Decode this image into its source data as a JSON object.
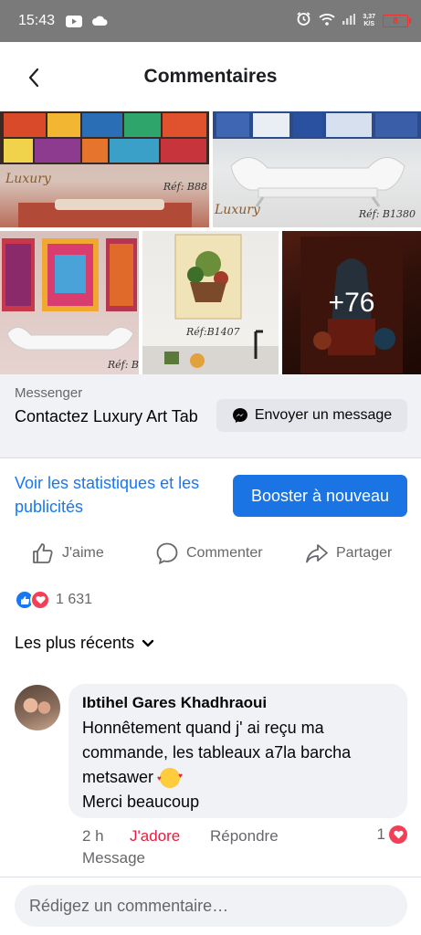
{
  "status_bar": {
    "time": "15:43",
    "net_speed_top": "3,37",
    "net_speed_bottom": "K/S",
    "battery": "8"
  },
  "header": {
    "title": "Commentaires"
  },
  "gallery": {
    "refs": [
      "Réf: B88",
      "Réf: B1380",
      "Réf: B",
      "Réf:B1407"
    ],
    "brand": "Luxury",
    "more_count": "+76"
  },
  "messenger": {
    "label": "Messenger",
    "contact": "Contactez Luxury Art Tab",
    "send_label": "Envoyer un message"
  },
  "promo": {
    "stats_link": "Voir les statistiques et les publicités",
    "boost_label": "Booster à nouveau"
  },
  "actions": {
    "like": "J'aime",
    "comment": "Commenter",
    "share": "Partager"
  },
  "reactions": {
    "count": "1 631"
  },
  "sort": {
    "label": "Les plus récents"
  },
  "comment": {
    "author": "Ibtihel Gares Khadhraoui",
    "line1": "Honnêtement quand j' ai reçu ma commande, les tableaux a7la barcha metsawer",
    "line2": "Merci beaucoup",
    "time": "2 h",
    "reaction_label": "J'adore",
    "reply_label": "Répondre",
    "reaction_count": "1",
    "message_label": "Message"
  },
  "composer": {
    "placeholder": "Rédigez un commentaire…"
  },
  "colors": {
    "accent": "#1877f2",
    "love": "#f33e58",
    "adore": "#e41e3f",
    "muted": "#65676b"
  }
}
